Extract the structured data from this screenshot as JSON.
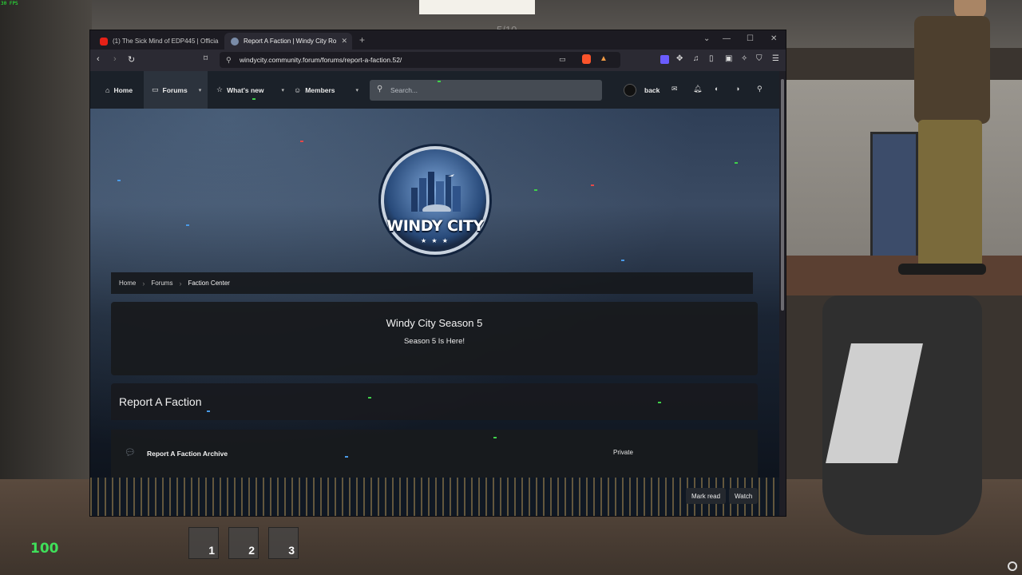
{
  "game": {
    "fps_label": "30 FPS",
    "health": "100",
    "overlay_counter": "5/10",
    "hotbar": [
      "1",
      "2",
      "3"
    ]
  },
  "browser": {
    "tabs": [
      {
        "title": "(1) The Sick Mind of EDP445 | Officia",
        "favicon": "youtube-icon"
      },
      {
        "title": "Report A Faction | Windy City Ro",
        "favicon": "forum-icon"
      }
    ],
    "url": "windycity.community.forum/forums/report-a-faction.52/"
  },
  "forum": {
    "nav": {
      "home": "Home",
      "forums": "Forums",
      "whats_new": "What's new",
      "members": "Members"
    },
    "search_placeholder": "Search...",
    "username": "back",
    "logo": {
      "text": "WINDY CITY",
      "stars": "★ ★ ★"
    },
    "breadcrumb": [
      "Home",
      "Forums",
      "Faction Center"
    ],
    "notice": {
      "title": "Windy City Season 5",
      "subtitle": "Season 5 Is Here!"
    },
    "forum_title": "Report A Faction",
    "subforum": {
      "title": "Report A Faction Archive",
      "status": "Private"
    },
    "actions": {
      "mark_read": "Mark read",
      "watch": "Watch"
    }
  },
  "colors": {
    "nav_bg": "#1b2129",
    "card_bg": "#181a1e",
    "browser_bg": "#1c1b22",
    "health_green": "#3fe05a"
  }
}
